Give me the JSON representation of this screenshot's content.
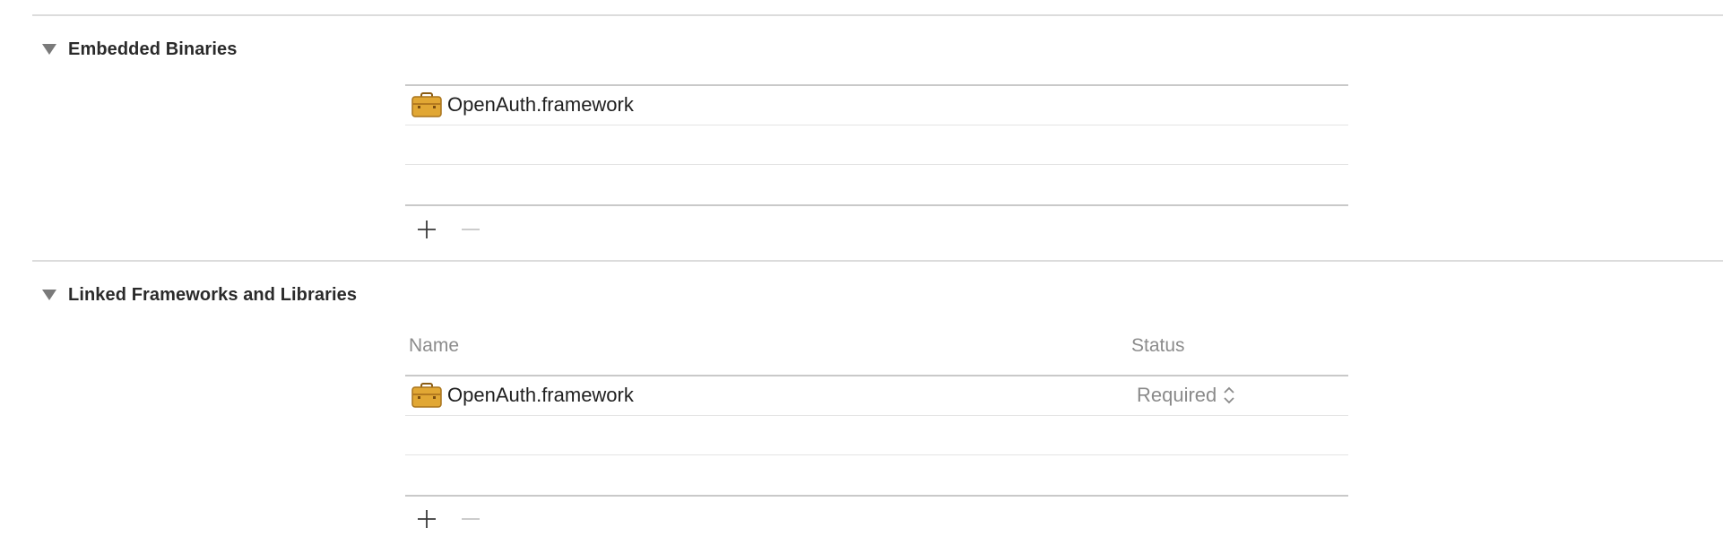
{
  "embedded_binaries": {
    "title": "Embedded Binaries",
    "items": [
      {
        "name": "OpenAuth.framework",
        "icon": "framework-toolbox-icon"
      }
    ]
  },
  "linked_frameworks": {
    "title": "Linked Frameworks and Libraries",
    "columns": {
      "name": "Name",
      "status": "Status"
    },
    "items": [
      {
        "name": "OpenAuth.framework",
        "status": "Required",
        "icon": "framework-toolbox-icon"
      }
    ]
  },
  "controls": {
    "add_icon": "plus-icon",
    "remove_icon": "minus-icon",
    "disclosure_icon": "disclosure-triangle-down-icon"
  },
  "colors": {
    "separator": "#dcdcdc",
    "row_line": "#e4e4e4",
    "icon_gold": "#e1a734",
    "muted_text": "#8a8a8a"
  }
}
